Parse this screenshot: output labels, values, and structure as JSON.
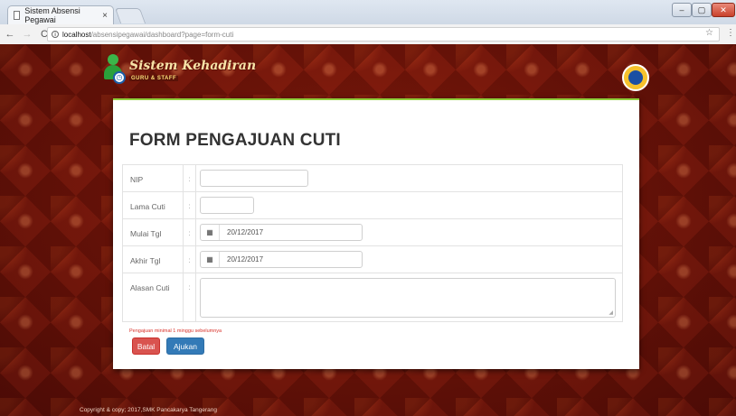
{
  "browser": {
    "tab_title": "Sistem Absensi Pegawai",
    "tab_close": "×",
    "url_host": "localhost",
    "url_path": "/absensipegawai/dashboard?page=form-cuti",
    "win_min": "–",
    "win_max": "▢",
    "win_close": "✕"
  },
  "header": {
    "brand_title": "Sistem Kehadiran",
    "brand_sub": "GURU & STAFF"
  },
  "form": {
    "title": "FORM PENGAJUAN CUTI",
    "sep": ":",
    "fields": {
      "nip_label": "NIP",
      "lama_label": "Lama Cuti",
      "mulai_label": "Mulai Tgl",
      "mulai_value": "20/12/2017",
      "akhir_label": "Akhir Tgl",
      "akhir_value": "20/12/2017",
      "alasan_label": "Alasan Cuti"
    },
    "note": "Pengajuan minimal 1 minggu sebelumnya",
    "batal_label": "Batal",
    "ajukan_label": "Ajukan"
  },
  "footer": {
    "text": "Copyright & copy; 2017,SMK Pancakarya Tangerang"
  },
  "icons": {
    "calendar": "calendar-icon",
    "info": "info-icon",
    "star": "star-icon"
  },
  "colors": {
    "accent_green": "#8fce3c",
    "danger": "#d9534f",
    "primary": "#337ab7",
    "note_red": "#d9322a"
  }
}
